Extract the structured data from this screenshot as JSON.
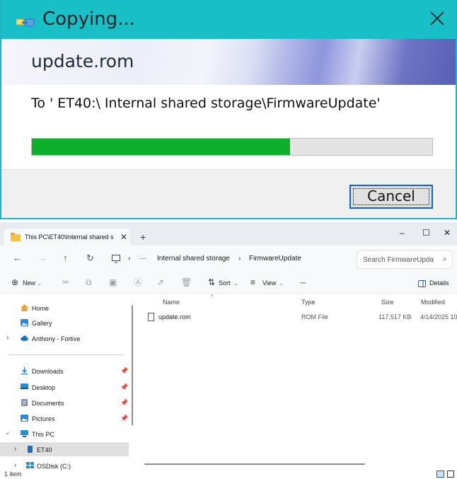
{
  "dialog": {
    "title": "Copying...",
    "file_name": "update.rom",
    "destination": "To ' ET40:\\ Internal shared storage\\FirmwareUpdate'",
    "progress": 0.645,
    "cancel_label": "Cancel",
    "colors": {
      "titlebar": "#19bfc7",
      "progress": "#0cb02b"
    }
  },
  "explorer": {
    "tab_title": "This PC\\ET40\\Internal shared s",
    "window_controls": {
      "minimize": "–",
      "maximize": "☐",
      "close": "✕"
    },
    "breadcrumb": [
      "···",
      "Internal shared storage",
      "FirmwareUpdate"
    ],
    "search_placeholder": "Search FirmwareUpda",
    "toolbar": {
      "new_label": "New",
      "sort_label": "Sort",
      "view_label": "View",
      "more_label": "···",
      "details_label": "Details"
    },
    "sidebar": [
      {
        "label": "Home",
        "icon": "home-icon"
      },
      {
        "label": "Gallery",
        "icon": "gallery-icon"
      },
      {
        "label": "Anthony - Fortive",
        "icon": "cloud-icon"
      },
      {
        "label": "Downloads",
        "icon": "download-icon"
      },
      {
        "label": "Desktop",
        "icon": "desktop-icon"
      },
      {
        "label": "Documents",
        "icon": "documents-icon"
      },
      {
        "label": "Pictures",
        "icon": "pictures-icon"
      },
      {
        "label": "This PC",
        "icon": "pc-icon"
      },
      {
        "label": "ET40",
        "icon": "device-icon"
      },
      {
        "label": "OSDisk (C:)",
        "icon": "drive-icon"
      }
    ],
    "columns": {
      "name": "Name",
      "type": "Type",
      "size": "Size",
      "modified": "Modified"
    },
    "files": [
      {
        "name": "update.rom",
        "type": "ROM File",
        "size": "117,517 KB",
        "modified": "4/14/2025 10:"
      }
    ],
    "status": "1 item"
  }
}
